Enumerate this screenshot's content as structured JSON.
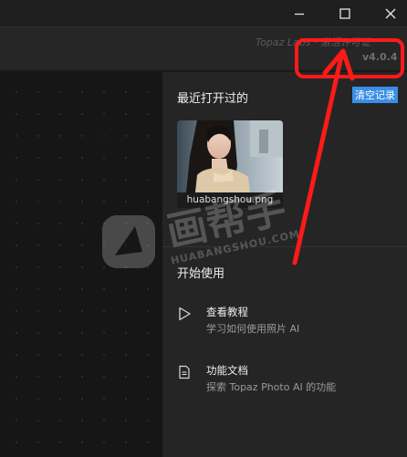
{
  "window": {
    "brand_text": "Topaz Labs · 激活许可证",
    "minimize_icon": "minimize-icon",
    "maximize_icon": "maximize-icon",
    "close_icon": "close-icon"
  },
  "panel": {
    "version": "v4.0.4",
    "recent": {
      "title": "最近打开过的",
      "clear_label": "清空记录",
      "files": [
        {
          "name": "huabangshou.png"
        }
      ]
    },
    "start": {
      "title": "开始使用",
      "items": [
        {
          "icon": "play-icon",
          "title": "查看教程",
          "subtitle": "学习如何使用照片 AI"
        },
        {
          "icon": "document-icon",
          "title": "功能文档",
          "subtitle": "探索 Topaz Photo AI 的功能"
        }
      ]
    }
  },
  "watermark": {
    "text": "画帮手",
    "subtext": "HUABANGSHOU.COM"
  },
  "colors": {
    "accent": "#3a8ee6",
    "annotation": "#ff1a1a"
  }
}
